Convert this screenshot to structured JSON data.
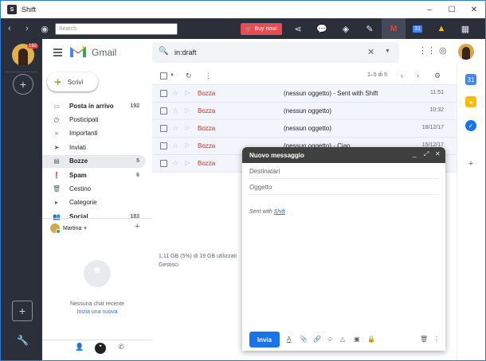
{
  "window": {
    "title": "Shift",
    "min": "–",
    "max": "☐",
    "close": "✕"
  },
  "shift_toolbar": {
    "back": "‹",
    "forward": "›",
    "search_placeholder": "Search",
    "buy_now": "Buy now!"
  },
  "rail": {
    "badge": "192",
    "add": "+",
    "add_app": "+",
    "settings": "🔧"
  },
  "gmail": {
    "brand": "Gmail",
    "search_query": "in:draft",
    "compose_label": "Scrivi",
    "nav": [
      {
        "icon": "▭",
        "label": "Posta in arrivo",
        "count": "192",
        "bold": true
      },
      {
        "icon": "◷",
        "label": "Posticipati",
        "count": ""
      },
      {
        "icon": "»",
        "label": "Importanti",
        "count": ""
      },
      {
        "icon": "➤",
        "label": "Inviati",
        "count": ""
      },
      {
        "icon": "▤",
        "label": "Bozze",
        "count": "5",
        "bold": true,
        "selected": true
      },
      {
        "icon": "❗",
        "label": "Spam",
        "count": "6",
        "bold": true
      },
      {
        "icon": "🗑",
        "label": "Cestino",
        "count": ""
      },
      {
        "icon": "▸",
        "label": "Categorie",
        "count": ""
      },
      {
        "icon": "👥",
        "label": "Social",
        "count": "183",
        "bold": true
      }
    ],
    "hangouts": {
      "user": "Martina",
      "empty": "Nessuna chat recente",
      "start": "Inizia una nuova"
    },
    "list": {
      "pager": "1–5 di 5",
      "rows": [
        {
          "from": "Bozza",
          "subject": "(nessun oggetto) - Sent with Shift",
          "date": "11:51"
        },
        {
          "from": "Bozza",
          "subject": "(nessun oggetto)",
          "date": "10:32"
        },
        {
          "from": "Bozza",
          "subject": "(nessun oggetto)",
          "date": "18/12/17"
        },
        {
          "from": "Bozza",
          "subject": "(nessun oggetto) - Ciao",
          "date": "15/12/17"
        },
        {
          "from": "Bozza",
          "subject": "",
          "date": ""
        }
      ],
      "storage": "1,11 GB (5%) di 19 GB utilizzati",
      "manage": "Gestisci"
    },
    "compose": {
      "title": "Nuovo messaggio",
      "to_placeholder": "Destinatari",
      "subject_placeholder": "Oggetto",
      "signature_prefix": "Sent with",
      "signature_link": "Shift",
      "send": "Invia"
    }
  },
  "colors": {
    "rail": "#2b2f3a",
    "accent": "#1a73e8",
    "draft_red": "#d93025",
    "buy_now": "#e84c4c"
  }
}
